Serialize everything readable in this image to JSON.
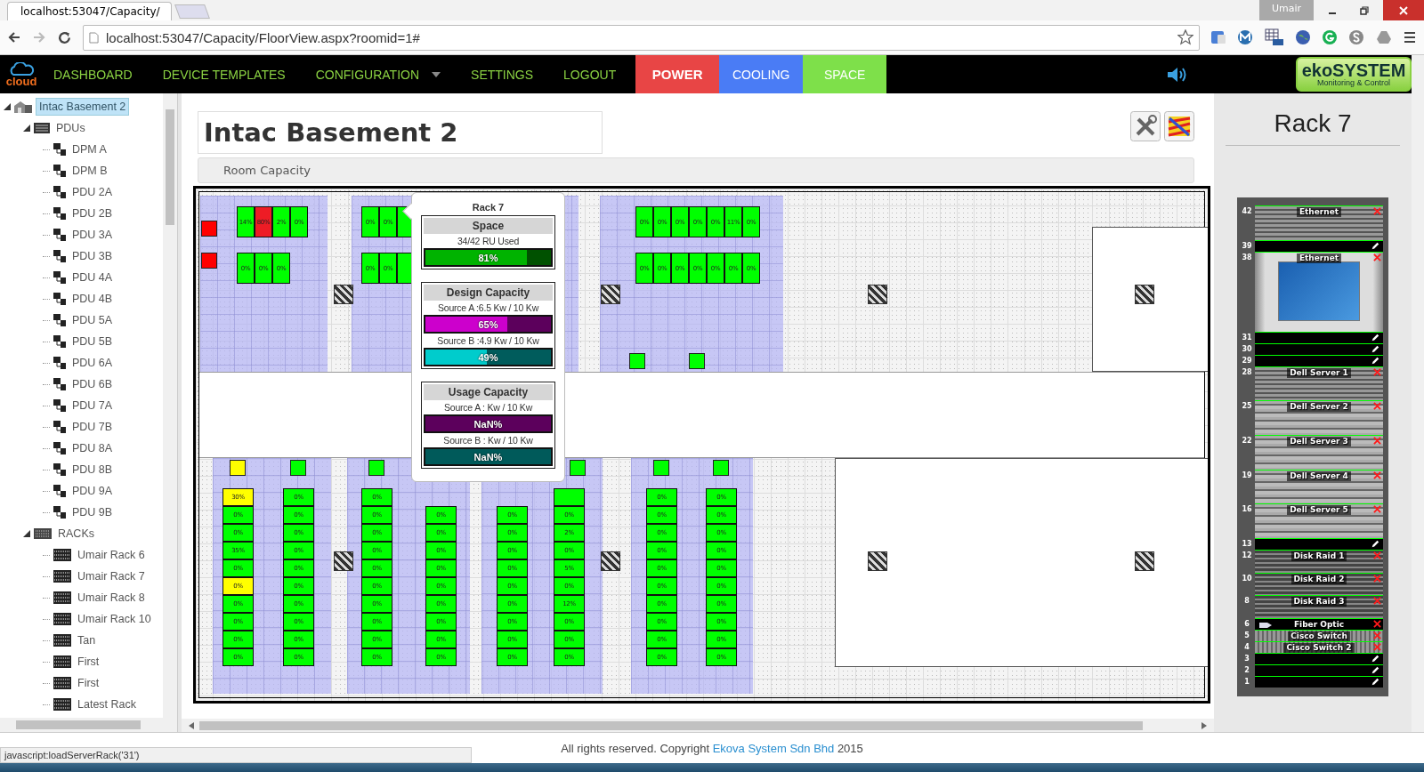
{
  "browser": {
    "tab_title": "localhost:53047/Capacity/",
    "user": "Umair",
    "url": "localhost:53047/Capacity/FloorView.aspx?roomid=1#"
  },
  "nav": {
    "logo": "cloud",
    "items": [
      {
        "kind": "link",
        "label": "DASHBOARD",
        "selected": false
      },
      {
        "kind": "link",
        "label": "DEVICE TEMPLATES",
        "selected": false
      },
      {
        "kind": "dropdown",
        "label": "CONFIGURATION",
        "selected": false
      },
      {
        "kind": "link",
        "label": "SETTINGS",
        "selected": false
      },
      {
        "kind": "link",
        "label": "LOGOUT",
        "selected": false
      },
      {
        "kind": "mode",
        "label": "POWER",
        "color": "#e84545",
        "selected": true
      },
      {
        "kind": "mode",
        "label": "COOLING",
        "color": "#4a7cf5",
        "selected": false
      },
      {
        "kind": "mode",
        "label": "SPACE",
        "color": "#7ee04a",
        "selected": false
      }
    ],
    "brand": {
      "name": "ekoSYSTEM",
      "tagline": "Monitoring & Control"
    }
  },
  "tree": {
    "items": [
      {
        "kind": "room",
        "label": "Intac Basement 2",
        "selected": true,
        "expanded": true,
        "children": [
          {
            "kind": "pdu-group",
            "label": "PDUs",
            "selected": false,
            "expanded": true,
            "children": [
              {
                "kind": "pdu",
                "label": "DPM A",
                "selected": false
              },
              {
                "kind": "pdu",
                "label": "DPM B",
                "selected": false
              },
              {
                "kind": "pdu",
                "label": "PDU 2A",
                "selected": false
              },
              {
                "kind": "pdu",
                "label": "PDU 2B",
                "selected": false
              },
              {
                "kind": "pdu",
                "label": "PDU 3A",
                "selected": false
              },
              {
                "kind": "pdu",
                "label": "PDU 3B",
                "selected": false
              },
              {
                "kind": "pdu",
                "label": "PDU 4A",
                "selected": false
              },
              {
                "kind": "pdu",
                "label": "PDU 4B",
                "selected": false
              },
              {
                "kind": "pdu",
                "label": "PDU 5A",
                "selected": false
              },
              {
                "kind": "pdu",
                "label": "PDU 5B",
                "selected": false
              },
              {
                "kind": "pdu",
                "label": "PDU 6A",
                "selected": false
              },
              {
                "kind": "pdu",
                "label": "PDU 6B",
                "selected": false
              },
              {
                "kind": "pdu",
                "label": "PDU 7A",
                "selected": false
              },
              {
                "kind": "pdu",
                "label": "PDU 7B",
                "selected": false
              },
              {
                "kind": "pdu",
                "label": "PDU 8A",
                "selected": false
              },
              {
                "kind": "pdu",
                "label": "PDU 8B",
                "selected": false
              },
              {
                "kind": "pdu",
                "label": "PDU 9A",
                "selected": false
              },
              {
                "kind": "pdu",
                "label": "PDU 9B",
                "selected": false
              }
            ]
          },
          {
            "kind": "rack-group",
            "label": "RACKs",
            "selected": false,
            "expanded": true,
            "children": [
              {
                "kind": "rack",
                "label": "Umair Rack 6",
                "selected": false
              },
              {
                "kind": "rack",
                "label": "Umair Rack 7",
                "selected": false
              },
              {
                "kind": "rack",
                "label": "Umair Rack 8",
                "selected": false
              },
              {
                "kind": "rack",
                "label": "Umair Rack 10",
                "selected": false
              },
              {
                "kind": "rack",
                "label": "Tan",
                "selected": false
              },
              {
                "kind": "rack",
                "label": "First",
                "selected": false
              },
              {
                "kind": "rack",
                "label": "First",
                "selected": false
              },
              {
                "kind": "rack",
                "label": "Latest Rack",
                "selected": false
              }
            ]
          }
        ]
      }
    ]
  },
  "page": {
    "title": "Intac Basement 2",
    "section": "Room Capacity"
  },
  "floor_plan": {
    "top_aisles": [
      {
        "markers": [
          {
            "color": "#ff0000"
          },
          {
            "color": "#ff0000"
          }
        ],
        "rows": [
          [
            {
              "label": "14%",
              "color": "#00ff00"
            },
            {
              "label": "80%",
              "color": "#ee1c25"
            },
            {
              "label": "2%",
              "color": "#00ff00"
            },
            {
              "label": "0%",
              "color": "#00ff00"
            }
          ],
          [
            {
              "label": "0%",
              "color": "#00ff00"
            },
            {
              "label": "0%",
              "color": "#00ff00"
            },
            {
              "label": "0%",
              "color": "#00ff00"
            }
          ]
        ]
      },
      {
        "rows": [
          [
            {
              "label": "0%",
              "color": "#00ff00"
            },
            {
              "label": "0%",
              "color": "#00ff00"
            },
            {
              "color": "#00ff00"
            }
          ],
          [
            {
              "label": "0%",
              "color": "#00ff00"
            },
            {
              "label": "0%",
              "color": "#00ff00"
            },
            {
              "color": "#00ff00"
            }
          ]
        ]
      },
      {
        "markers": [
          {
            "color": "#00ff00"
          },
          {
            "color": "#00ff00"
          }
        ],
        "rows": [
          [
            {
              "label": "0%",
              "color": "#00ff00"
            },
            {
              "label": "0%",
              "color": "#00ff00"
            },
            {
              "label": "0%",
              "color": "#00ff00"
            },
            {
              "label": "0%",
              "color": "#00ff00"
            },
            {
              "label": "0%",
              "color": "#00ff00"
            },
            {
              "label": "11%",
              "color": "#00ff00"
            },
            {
              "label": "0%",
              "color": "#00ff00"
            }
          ],
          [
            {
              "label": "0%",
              "color": "#00ff00"
            },
            {
              "label": "0%",
              "color": "#00ff00"
            },
            {
              "label": "0%",
              "color": "#00ff00"
            },
            {
              "label": "0%",
              "color": "#00ff00"
            },
            {
              "label": "0%",
              "color": "#00ff00"
            },
            {
              "label": "0%",
              "color": "#00ff00"
            },
            {
              "label": "0%",
              "color": "#00ff00"
            }
          ]
        ]
      }
    ],
    "bottom_aisles": [
      {
        "columns": [
          {
            "marker": {
              "color": "#ffff00"
            },
            "racks": [
              {
                "label": "30%",
                "color": "#ffff00"
              },
              {
                "label": "0%",
                "color": "#00ff00"
              },
              {
                "label": "0%",
                "color": "#00ff00"
              },
              {
                "label": "35%",
                "color": "#00ff00"
              },
              {
                "label": "0%",
                "color": "#00ff00"
              },
              {
                "label": "0%",
                "color": "#ffff00"
              },
              {
                "label": "0%",
                "color": "#00ff00"
              },
              {
                "label": "0%",
                "color": "#00ff00"
              },
              {
                "label": "0%",
                "color": "#00ff00"
              },
              {
                "label": "0%",
                "color": "#00ff00"
              }
            ]
          },
          {
            "marker": {
              "color": "#00ff00"
            },
            "racks": [
              {
                "label": "0%",
                "color": "#00ff00"
              },
              {
                "label": "0%",
                "color": "#00ff00"
              },
              {
                "label": "0%",
                "color": "#00ff00"
              },
              {
                "label": "0%",
                "color": "#00ff00"
              },
              {
                "label": "0%",
                "color": "#00ff00"
              },
              {
                "label": "0%",
                "color": "#00ff00"
              },
              {
                "label": "0%",
                "color": "#00ff00"
              },
              {
                "label": "0%",
                "color": "#00ff00"
              },
              {
                "label": "0%",
                "color": "#00ff00"
              },
              {
                "label": "0%",
                "color": "#00ff00"
              }
            ]
          }
        ]
      },
      {
        "columns": [
          {
            "marker": {
              "color": "#00ff00"
            },
            "racks": [
              {
                "label": "0%",
                "color": "#00ff00"
              },
              {
                "label": "0%",
                "color": "#00ff00"
              },
              {
                "label": "0%",
                "color": "#00ff00"
              },
              {
                "label": "0%",
                "color": "#00ff00"
              },
              {
                "label": "0%",
                "color": "#00ff00"
              },
              {
                "label": "0%",
                "color": "#00ff00"
              },
              {
                "label": "0%",
                "color": "#00ff00"
              },
              {
                "label": "0%",
                "color": "#00ff00"
              },
              {
                "label": "0%",
                "color": "#00ff00"
              },
              {
                "label": "0%",
                "color": "#00ff00"
              }
            ]
          },
          {
            "racks": [
              {
                "label": "0%",
                "color": "#00ff00"
              },
              {
                "label": "0%",
                "color": "#00ff00"
              },
              {
                "label": "0%",
                "color": "#00ff00"
              },
              {
                "label": "0%",
                "color": "#00ff00"
              },
              {
                "label": "0%",
                "color": "#00ff00"
              },
              {
                "label": "0%",
                "color": "#00ff00"
              },
              {
                "label": "0%",
                "color": "#00ff00"
              },
              {
                "label": "0%",
                "color": "#00ff00"
              },
              {
                "label": "0%",
                "color": "#00ff00"
              }
            ]
          }
        ]
      },
      {
        "columns": [
          {
            "racks": [
              {
                "label": "0%",
                "color": "#00ff00"
              },
              {
                "label": "0%",
                "color": "#00ff00"
              },
              {
                "label": "0%",
                "color": "#00ff00"
              },
              {
                "label": "0%",
                "color": "#00ff00"
              },
              {
                "label": "0%",
                "color": "#00ff00"
              },
              {
                "label": "0%",
                "color": "#00ff00"
              },
              {
                "label": "0%",
                "color": "#00ff00"
              },
              {
                "label": "0%",
                "color": "#00ff00"
              },
              {
                "label": "0%",
                "color": "#00ff00"
              }
            ]
          },
          {
            "marker": {
              "color": "#00ff00"
            },
            "racks": [
              {
                "color": "#00ff00"
              },
              {
                "label": "0%",
                "color": "#00ff00"
              },
              {
                "label": "2%",
                "color": "#00ff00"
              },
              {
                "label": "0%",
                "color": "#00ff00"
              },
              {
                "label": "5%",
                "color": "#00ff00"
              },
              {
                "label": "0%",
                "color": "#00ff00"
              },
              {
                "label": "12%",
                "color": "#00ff00"
              },
              {
                "label": "0%",
                "color": "#00ff00"
              },
              {
                "label": "0%",
                "color": "#00ff00"
              },
              {
                "label": "0%",
                "color": "#00ff00"
              }
            ]
          }
        ]
      },
      {
        "columns": [
          {
            "marker": {
              "color": "#00ff00"
            },
            "racks": [
              {
                "label": "0%",
                "color": "#00ff00"
              },
              {
                "label": "0%",
                "color": "#00ff00"
              },
              {
                "label": "0%",
                "color": "#00ff00"
              },
              {
                "label": "0%",
                "color": "#00ff00"
              },
              {
                "label": "0%",
                "color": "#00ff00"
              },
              {
                "label": "0%",
                "color": "#00ff00"
              },
              {
                "label": "0%",
                "color": "#00ff00"
              },
              {
                "label": "0%",
                "color": "#00ff00"
              },
              {
                "label": "0%",
                "color": "#00ff00"
              },
              {
                "label": "0%",
                "color": "#00ff00"
              }
            ]
          },
          {
            "marker": {
              "color": "#00ff00"
            },
            "racks": [
              {
                "label": "0%",
                "color": "#00ff00"
              },
              {
                "label": "0%",
                "color": "#00ff00"
              },
              {
                "label": "0%",
                "color": "#00ff00"
              },
              {
                "label": "0%",
                "color": "#00ff00"
              },
              {
                "label": "0%",
                "color": "#00ff00"
              },
              {
                "label": "0%",
                "color": "#00ff00"
              },
              {
                "label": "0%",
                "color": "#00ff00"
              },
              {
                "label": "0%",
                "color": "#00ff00"
              },
              {
                "label": "0%",
                "color": "#00ff00"
              },
              {
                "label": "0%",
                "color": "#00ff00"
              }
            ]
          }
        ]
      }
    ]
  },
  "popup": {
    "title": "Rack 7",
    "sections": [
      {
        "title": "Space",
        "rows": [
          {
            "kind": "text",
            "text": "34/42 RU Used"
          },
          {
            "kind": "bar",
            "reading": "81%",
            "level": 0.81,
            "color": "#00b300"
          }
        ]
      },
      {
        "title": "Design Capacity",
        "rows": [
          {
            "kind": "text",
            "text": "Source A :6.5 Kw / 10 Kw"
          },
          {
            "kind": "bar",
            "reading": "65%",
            "level": 0.65,
            "color": "#cc00cc"
          },
          {
            "kind": "text",
            "text": "Source B :4.9 Kw / 10 Kw"
          },
          {
            "kind": "bar",
            "reading": "49%",
            "level": 0.49,
            "color": "#00cccc"
          }
        ]
      },
      {
        "title": "Usage Capacity",
        "rows": [
          {
            "kind": "text",
            "text": "Source A : Kw / 10 Kw"
          },
          {
            "kind": "bar",
            "reading": "NaN%",
            "color": "#5c005c"
          },
          {
            "kind": "text",
            "text": "Source B : Kw / 10 Kw"
          },
          {
            "kind": "bar",
            "reading": "NaN%",
            "color": "#005a5a"
          }
        ]
      }
    ]
  },
  "rack_panel": {
    "title": "Rack 7",
    "slots": [
      {
        "kind": "server",
        "unit": "42",
        "name": "Ethernet"
      },
      {
        "kind": "empty",
        "unit": "39"
      },
      {
        "kind": "monitor",
        "unit": "38",
        "name": "Ethernet"
      },
      {
        "kind": "empty",
        "unit": "31"
      },
      {
        "kind": "empty",
        "unit": "30"
      },
      {
        "kind": "empty",
        "unit": "29"
      },
      {
        "kind": "server",
        "unit": "28",
        "name": "Dell Server 1"
      },
      {
        "kind": "blade",
        "unit": "25",
        "name": "Dell Server 2"
      },
      {
        "kind": "blade",
        "unit": "22",
        "name": "Dell Server 3"
      },
      {
        "kind": "blade",
        "unit": "19",
        "name": "Dell Server 4"
      },
      {
        "kind": "blade",
        "unit": "16",
        "name": "Dell Server 5"
      },
      {
        "kind": "empty",
        "unit": "13"
      },
      {
        "kind": "disk",
        "unit": "12",
        "name": "Disk Raid 1"
      },
      {
        "kind": "disk",
        "unit": "10",
        "name": "Disk Raid 2"
      },
      {
        "kind": "disk",
        "unit": "8",
        "name": "Disk Raid 3"
      },
      {
        "kind": "fiber",
        "unit": "6",
        "name": "Fiber Optic"
      },
      {
        "kind": "switch",
        "unit": "5",
        "name": "Cisco Switch"
      },
      {
        "kind": "switch",
        "unit": "4",
        "name": "Cisco Switch 2"
      },
      {
        "kind": "empty",
        "unit": "3"
      },
      {
        "kind": "empty",
        "unit": "2"
      },
      {
        "kind": "empty",
        "unit": "1"
      }
    ]
  },
  "footer": {
    "text": "All rights reserved. Copyright",
    "link": "Ekova System Sdn Bhd",
    "year": "2015"
  },
  "status_bar": {
    "text": "javascript:loadServerRack('31')"
  }
}
